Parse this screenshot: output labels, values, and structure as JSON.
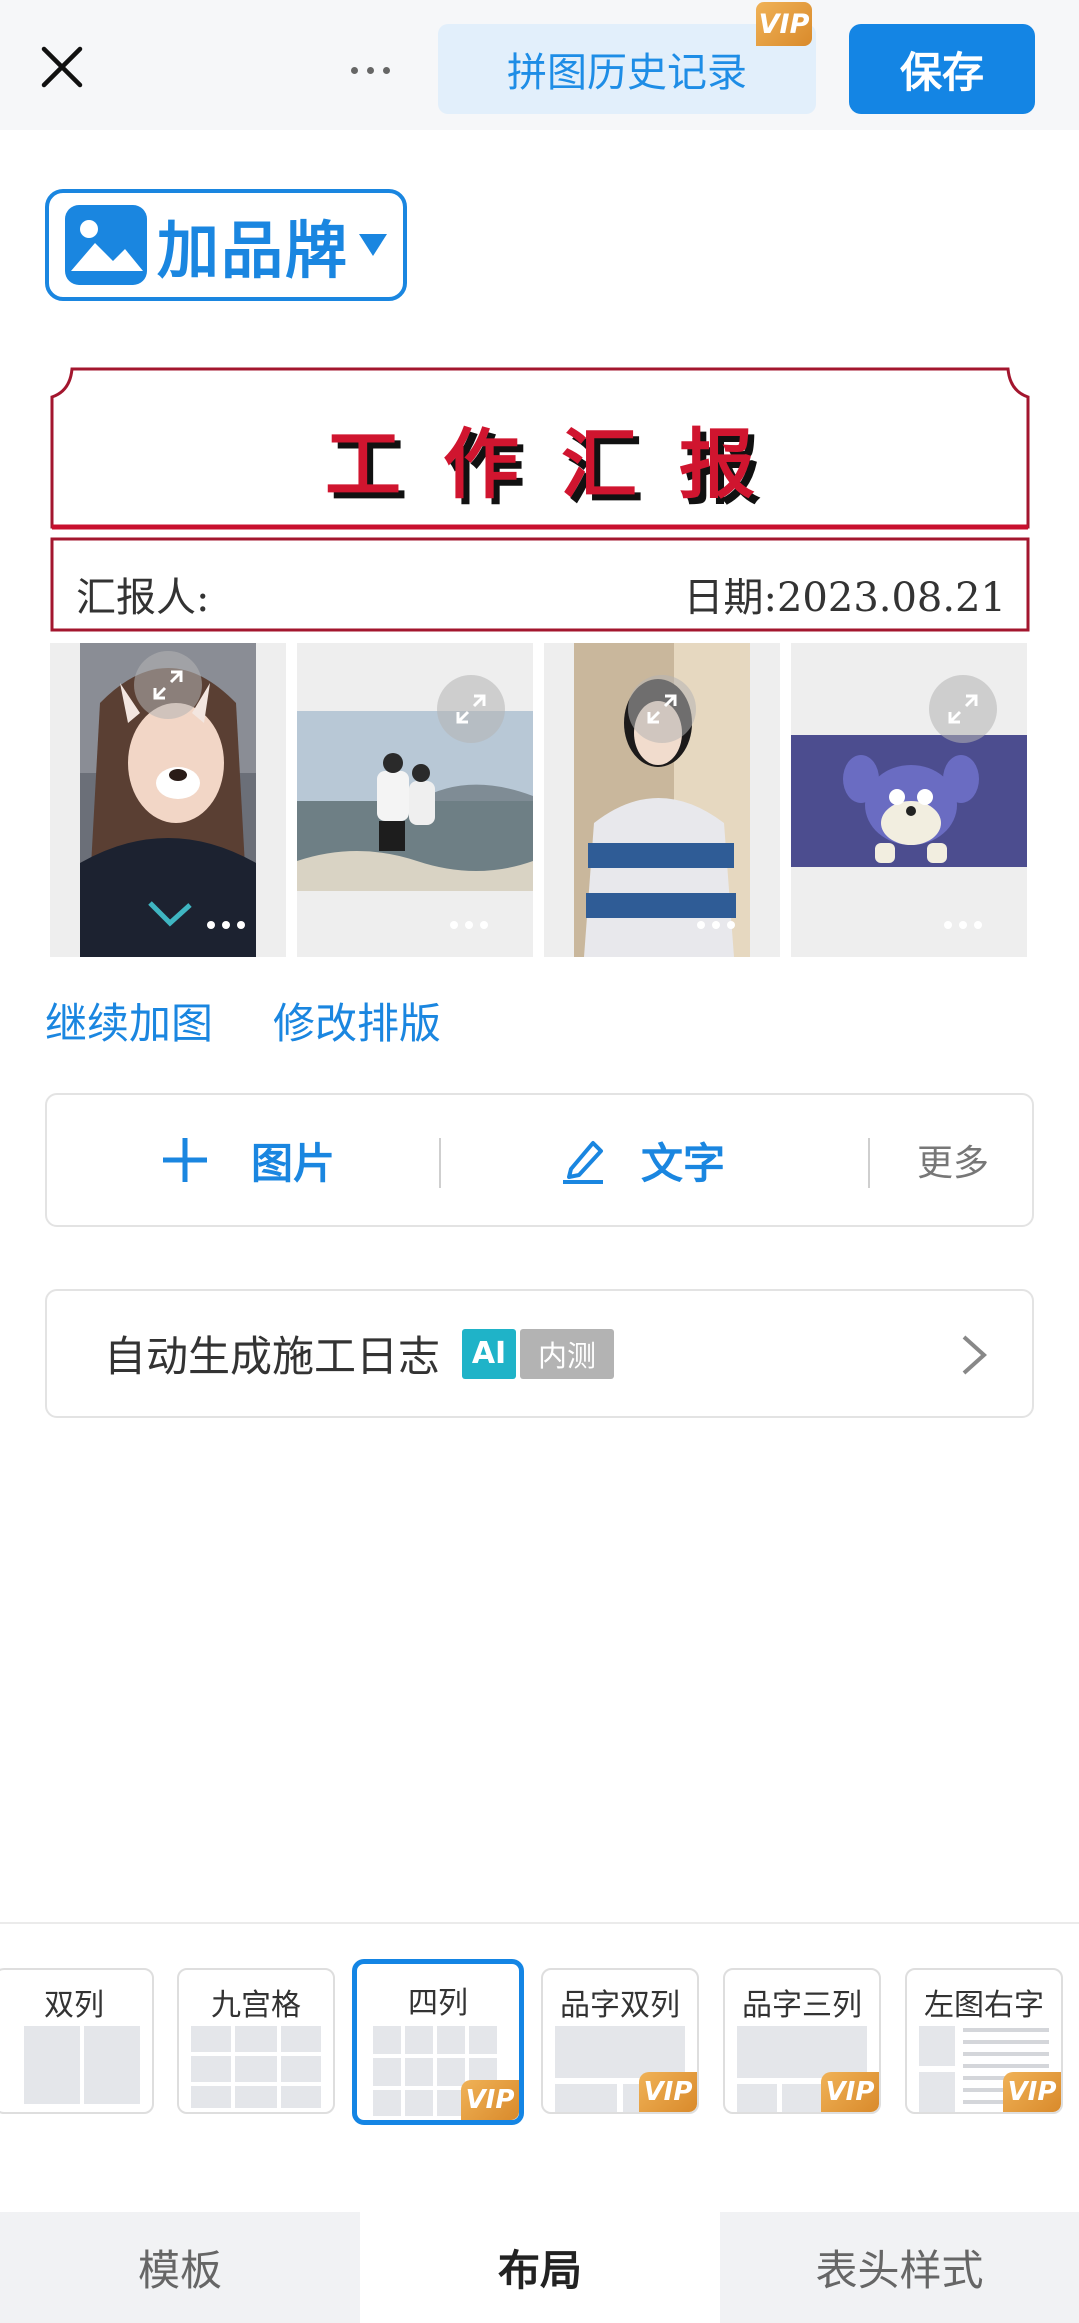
{
  "topbar": {
    "history_label": "拼图历史记录",
    "vip_label": "VIP",
    "save_label": "保存"
  },
  "brand": {
    "label": "加品牌"
  },
  "report": {
    "title": "工作汇报",
    "reporter_label": "汇报人:",
    "date_label": "日期:2023.08.21"
  },
  "links": {
    "add_more": "继续加图",
    "edit_layout": "修改排版"
  },
  "add_bar": {
    "image_label": "图片",
    "text_label": "文字",
    "more_label": "更多"
  },
  "autolog": {
    "label": "自动生成施工日志",
    "ai_badge": "AI",
    "beta_badge": "内测"
  },
  "layouts": [
    {
      "name": "双列",
      "vip": false,
      "selected": false
    },
    {
      "name": "九宫格",
      "vip": false,
      "selected": false
    },
    {
      "name": "四列",
      "vip": true,
      "selected": true
    },
    {
      "name": "品字双列",
      "vip": true,
      "selected": false
    },
    {
      "name": "品字三列",
      "vip": true,
      "selected": false
    },
    {
      "name": "左图右字",
      "vip": true,
      "selected": false
    }
  ],
  "tabs": {
    "template": "模板",
    "layout": "布局",
    "header_style": "表头样式",
    "active": "layout"
  },
  "colors": {
    "accent": "#1485e4",
    "report_red": "#d0152f",
    "vip_gold": "#e09a3a"
  }
}
